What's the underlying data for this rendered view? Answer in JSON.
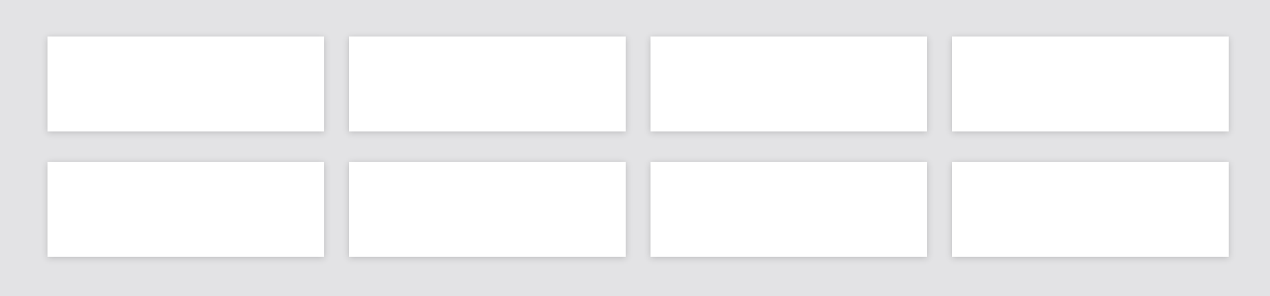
{
  "background_color": "#e3e3e5",
  "card_color": "#ffffff",
  "cards": [
    {
      "label": ""
    },
    {
      "label": ""
    },
    {
      "label": ""
    },
    {
      "label": ""
    },
    {
      "label": ""
    },
    {
      "label": ""
    },
    {
      "label": ""
    },
    {
      "label": ""
    }
  ]
}
